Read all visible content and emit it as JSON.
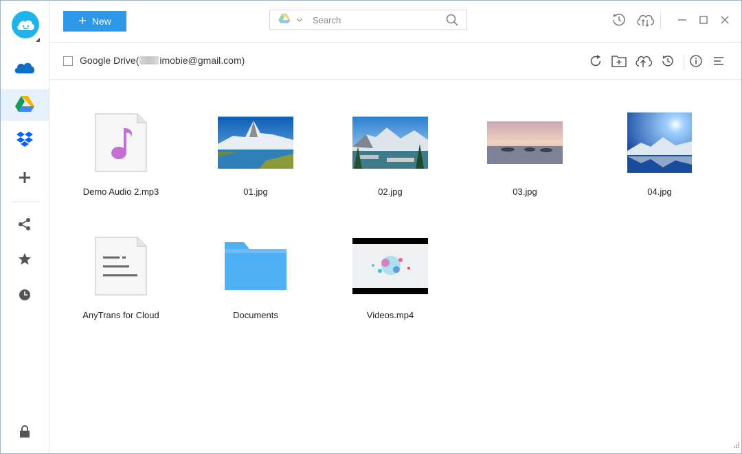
{
  "toolbar": {
    "new_label": "New",
    "search_placeholder": "Search"
  },
  "path": {
    "prefix": "Google Drive(",
    "account_suffix": "imobie@gmail.com)"
  },
  "sidebar": {
    "items": [
      {
        "name": "onedrive-icon"
      },
      {
        "name": "google-drive-icon",
        "active": true
      },
      {
        "name": "dropbox-icon"
      },
      {
        "name": "add-cloud-icon"
      },
      {
        "name": "share-icon"
      },
      {
        "name": "star-icon"
      },
      {
        "name": "history-icon"
      },
      {
        "name": "lock-icon"
      }
    ]
  },
  "files": [
    {
      "name": "Demo Audio 2.mp3",
      "type": "audio"
    },
    {
      "name": "01.jpg",
      "type": "image"
    },
    {
      "name": "02.jpg",
      "type": "image"
    },
    {
      "name": "03.jpg",
      "type": "image"
    },
    {
      "name": "04.jpg",
      "type": "image"
    },
    {
      "name": "AnyTrans for Cloud",
      "type": "document"
    },
    {
      "name": "Documents",
      "type": "folder"
    },
    {
      "name": "Videos.mp4",
      "type": "video"
    }
  ],
  "colors": {
    "accent": "#2e98e8",
    "logo": "#1cb4e9",
    "folder": "#4fb0f6",
    "audio_note": "#c46fd3"
  }
}
